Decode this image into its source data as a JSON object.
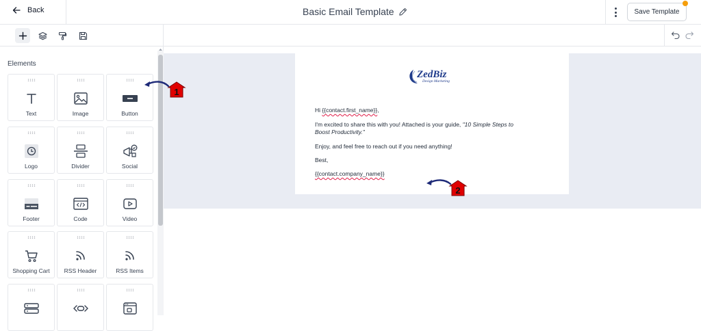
{
  "topbar": {
    "back_label": "Back",
    "title": "Basic Email Template",
    "save_label": "Save Template"
  },
  "sidebar": {
    "heading": "Elements",
    "elements": [
      {
        "label": "Text",
        "icon": "text-icon"
      },
      {
        "label": "Image",
        "icon": "image-icon"
      },
      {
        "label": "Button",
        "icon": "button-icon"
      },
      {
        "label": "Logo",
        "icon": "logo-icon"
      },
      {
        "label": "Divider",
        "icon": "divider-icon"
      },
      {
        "label": "Social",
        "icon": "social-icon"
      },
      {
        "label": "Footer",
        "icon": "footer-icon"
      },
      {
        "label": "Code",
        "icon": "code-icon"
      },
      {
        "label": "Video",
        "icon": "video-icon"
      },
      {
        "label": "Shopping Cart",
        "icon": "cart-icon"
      },
      {
        "label": "RSS Header",
        "icon": "rss-icon"
      },
      {
        "label": "RSS Items",
        "icon": "rss-icon"
      },
      {
        "label": "",
        "icon": "server-icon"
      },
      {
        "label": "",
        "icon": "embed-icon"
      },
      {
        "label": "",
        "icon": "browser-icon"
      }
    ]
  },
  "email": {
    "logo_text": "ZedBiz",
    "logo_sub": "Design Marketing",
    "greeting_pre": "Hi ",
    "greeting_var": "{{contact.first_name}}",
    "greeting_post": ",",
    "body_pre": "I'm excited to share this with you! Attached is your guide, ",
    "body_em_1": "\"10 Simple Steps to",
    "body_em_2": "Boost Productivity.\"",
    "line_enjoy": "Enjoy, and feel free to reach out if you need anything!",
    "line_best": "Best,",
    "signature_var": "{{contact.company_name}}"
  },
  "annotations": [
    {
      "number": "1",
      "color": "#e00000"
    },
    {
      "number": "2",
      "color": "#e00000"
    }
  ],
  "colors": {
    "accent_dot": "#f59e0b",
    "canvas_bg": "#e9ecf3",
    "arrow": "#1e2a78"
  }
}
